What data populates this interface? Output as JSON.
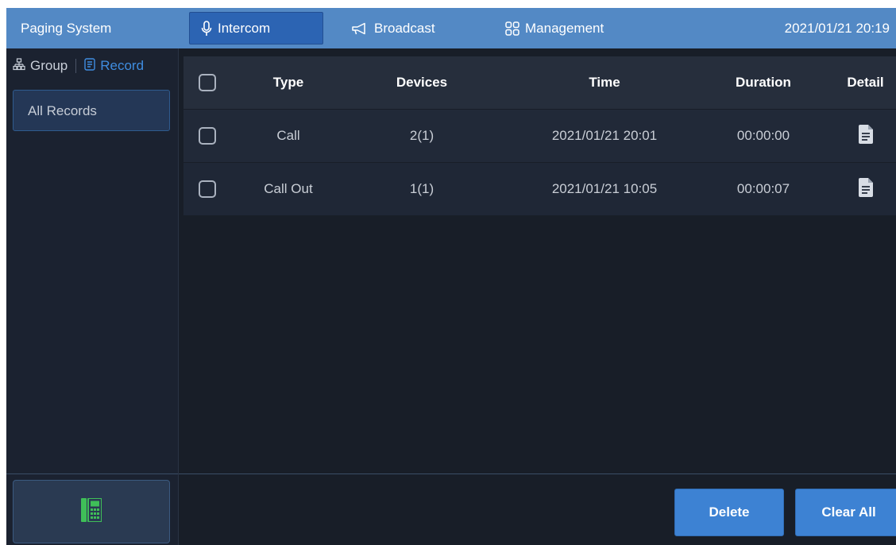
{
  "header": {
    "app_title": "Paging System",
    "tabs": [
      {
        "label": "Intercom",
        "icon": "microphone-icon",
        "active": true
      },
      {
        "label": "Broadcast",
        "icon": "megaphone-icon",
        "active": false
      },
      {
        "label": "Management",
        "icon": "grid-icon",
        "active": false
      }
    ],
    "datetime": "2021/01/21 20:19"
  },
  "sidebar": {
    "tabs": [
      {
        "label": "Group",
        "icon": "org-chart-icon",
        "active": false
      },
      {
        "label": "Record",
        "icon": "document-list-icon",
        "active": true
      }
    ],
    "items": [
      {
        "label": "All Records",
        "selected": true
      }
    ],
    "phone_button_icon": "phone-keypad-icon"
  },
  "table": {
    "columns": [
      "Type",
      "Devices",
      "Time",
      "Duration",
      "Detail"
    ],
    "rows": [
      {
        "type": "Call",
        "devices": "2(1)",
        "time": "2021/01/21 20:01",
        "duration": "00:00:00",
        "detail_icon": "document-icon",
        "checked": false
      },
      {
        "type": "Call Out",
        "devices": "1(1)",
        "time": "2021/01/21 10:05",
        "duration": "00:00:07",
        "detail_icon": "document-icon",
        "checked": false
      }
    ]
  },
  "actions": {
    "delete_label": "Delete",
    "clear_all_label": "Clear All"
  },
  "colors": {
    "topbar": "#5389c5",
    "active_tab": "#2c64b3",
    "accent": "#3f8de0",
    "button": "#3d82d3",
    "phone_icon": "#3fbf58"
  }
}
